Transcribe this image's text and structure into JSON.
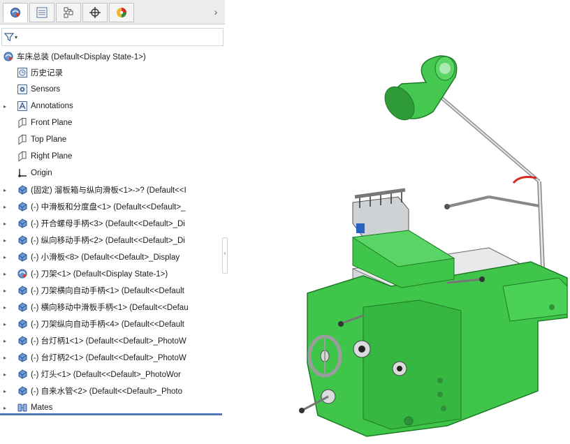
{
  "tabs": [
    {
      "icon": "feature-manager-icon",
      "active": true
    },
    {
      "icon": "property-manager-icon",
      "active": false
    },
    {
      "icon": "configuration-manager-icon",
      "active": false
    },
    {
      "icon": "dimxpert-manager-icon",
      "active": false
    },
    {
      "icon": "display-manager-icon",
      "active": false
    }
  ],
  "tab_expand": "›",
  "filter": {
    "icon": "filter-icon",
    "symbol": "▾",
    "value": ""
  },
  "tree": {
    "root": "车床总装  (Default<Display State-1>)",
    "items": [
      {
        "label": "历史记录",
        "icon": "history-icon",
        "caret": ""
      },
      {
        "label": "Sensors",
        "icon": "sensors-icon",
        "caret": ""
      },
      {
        "label": "Annotations",
        "icon": "annotations-icon",
        "caret": "▸"
      },
      {
        "label": "Front Plane",
        "icon": "plane-icon",
        "caret": ""
      },
      {
        "label": "Top Plane",
        "icon": "plane-icon",
        "caret": ""
      },
      {
        "label": "Right Plane",
        "icon": "plane-icon",
        "caret": ""
      },
      {
        "label": "Origin",
        "icon": "origin-icon",
        "caret": ""
      },
      {
        "label": "(固定) 溜板箱与纵向滑板<1>->? (Default<<I",
        "icon": "subassembly-icon",
        "caret": "▸"
      },
      {
        "label": "(-) 中滑板和分度盘<1> (Default<<Default>_",
        "icon": "subassembly-icon",
        "caret": "▸"
      },
      {
        "label": "(-) 开合螺母手柄<3> (Default<<Default>_Di",
        "icon": "subassembly-icon",
        "caret": "▸"
      },
      {
        "label": "(-) 纵向移动手柄<2> (Default<<Default>_Di",
        "icon": "subassembly-icon",
        "caret": "▸"
      },
      {
        "label": "(-) 小滑板<8> (Default<<Default>_Display",
        "icon": "subassembly-icon",
        "caret": "▸"
      },
      {
        "label": "(-) 刀架<1> (Default<Display State-1>)",
        "icon": "assembly-icon",
        "caret": "▸"
      },
      {
        "label": "(-) 刀架横向自动手柄<1> (Default<<Default",
        "icon": "subassembly-icon",
        "caret": "▸"
      },
      {
        "label": "(-) 横向移动中滑板手柄<1> (Default<<Defau",
        "icon": "subassembly-icon",
        "caret": "▸"
      },
      {
        "label": "(-) 刀架纵向自动手柄<4> (Default<<Default",
        "icon": "subassembly-icon",
        "caret": "▸"
      },
      {
        "label": "(-) 台灯柄1<1> (Default<<Default>_PhotoW",
        "icon": "subassembly-icon",
        "caret": "▸"
      },
      {
        "label": "(-) 台灯柄2<1> (Default<<Default>_PhotoW",
        "icon": "subassembly-icon",
        "caret": "▸"
      },
      {
        "label": "(-) 灯头<1> (Default<<Default>_PhotoWor",
        "icon": "subassembly-icon",
        "caret": "▸"
      },
      {
        "label": "(-) 自来水管<2> (Default<<Default>_Photo",
        "icon": "subassembly-icon",
        "caret": "▸"
      },
      {
        "label": "Mates",
        "icon": "mates-icon",
        "caret": "▸"
      }
    ]
  },
  "splitter_glyph": "‹",
  "colors": {
    "part_green": "#3fc64a",
    "part_dark_green": "#1f7a27",
    "metal_grey": "#c9ccce",
    "lamp_green": "#44c84f",
    "tree_blue": "#4a73b3"
  }
}
